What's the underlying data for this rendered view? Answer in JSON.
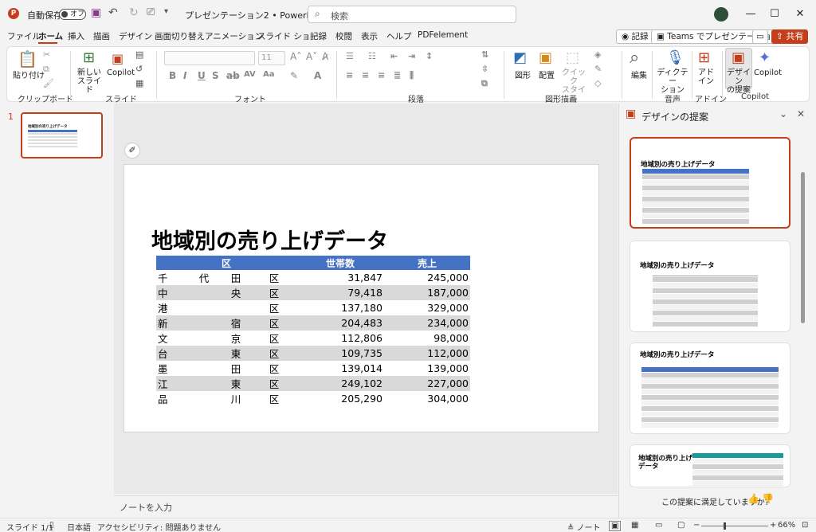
{
  "titlebar": {
    "autosave": "自動保存",
    "autosave_state": "オフ",
    "filename": "プレゼンテーション2",
    "separator": "•",
    "app": "PowerPoint",
    "search_placeholder": "検索"
  },
  "tabs": [
    "ファイル",
    "ホーム",
    "挿入",
    "描画",
    "デザイン",
    "画面切り替え",
    "アニメーション",
    "スライド ショー",
    "記録",
    "校閲",
    "表示",
    "ヘルプ",
    "PDFelement"
  ],
  "actions": {
    "record": "記録",
    "teams": "Teams でプレゼンテーション",
    "share": "共有"
  },
  "ribbon": {
    "paste": "貼り付け",
    "new_slide": "新しい\nスライド",
    "copilot": "Copilot",
    "shapes": "図形",
    "arrange": "配置",
    "quick_styles": "クイック\nスタイル",
    "edit": "編集",
    "dictate": "ディクテー\nション",
    "addin": "アド\nイン",
    "designer": "デザイン\nの提案",
    "copilot2": "Copilot",
    "groups": {
      "clipboard": "クリップボード",
      "slides": "スライド",
      "font": "フォント",
      "paragraph": "段落",
      "drawing": "図形描画",
      "voice": "音声",
      "addins": "アドイン",
      "copilot": "Copilot"
    },
    "font_size": "11"
  },
  "slide": {
    "number": "1",
    "title": "地域別の売り上げデータ",
    "headers": [
      "区",
      "世帯数",
      "売上"
    ],
    "rows": [
      {
        "a": "千",
        "b": "代",
        "c": "田",
        "d": "区",
        "households": "31,847",
        "sales": "245,000"
      },
      {
        "a": "中",
        "b": "",
        "c": "央",
        "d": "区",
        "households": "79,418",
        "sales": "187,000"
      },
      {
        "a": "港",
        "b": "",
        "c": "",
        "d": "区",
        "households": "137,180",
        "sales": "329,000"
      },
      {
        "a": "新",
        "b": "",
        "c": "宿",
        "d": "区",
        "households": "204,483",
        "sales": "234,000"
      },
      {
        "a": "文",
        "b": "",
        "c": "京",
        "d": "区",
        "households": "112,806",
        "sales": "98,000"
      },
      {
        "a": "台",
        "b": "",
        "c": "東",
        "d": "区",
        "households": "109,735",
        "sales": "112,000"
      },
      {
        "a": "墨",
        "b": "",
        "c": "田",
        "d": "区",
        "households": "139,014",
        "sales": "139,000"
      },
      {
        "a": "江",
        "b": "",
        "c": "東",
        "d": "区",
        "households": "249,102",
        "sales": "227,000"
      },
      {
        "a": "品",
        "b": "",
        "c": "川",
        "d": "区",
        "households": "205,290",
        "sales": "304,000"
      }
    ]
  },
  "notes_placeholder": "ノートを入力",
  "design_pane": {
    "title": "デザインの提案",
    "card_title": "地域別の売り上げデータ",
    "card4_title_1": "地域別の売り上げ",
    "card4_title_2": "データ",
    "feedback": "この提案に満足していますか?"
  },
  "status": {
    "slide": "スライド 1/1",
    "lang": "日本語",
    "accessibility": "アクセシビリティ: 問題ありません",
    "notes": "ノート",
    "zoom": "66%"
  },
  "colors": {
    "accent": "#c43e1c",
    "table_header": "#4472c4",
    "teal": "#1a9a9a"
  }
}
